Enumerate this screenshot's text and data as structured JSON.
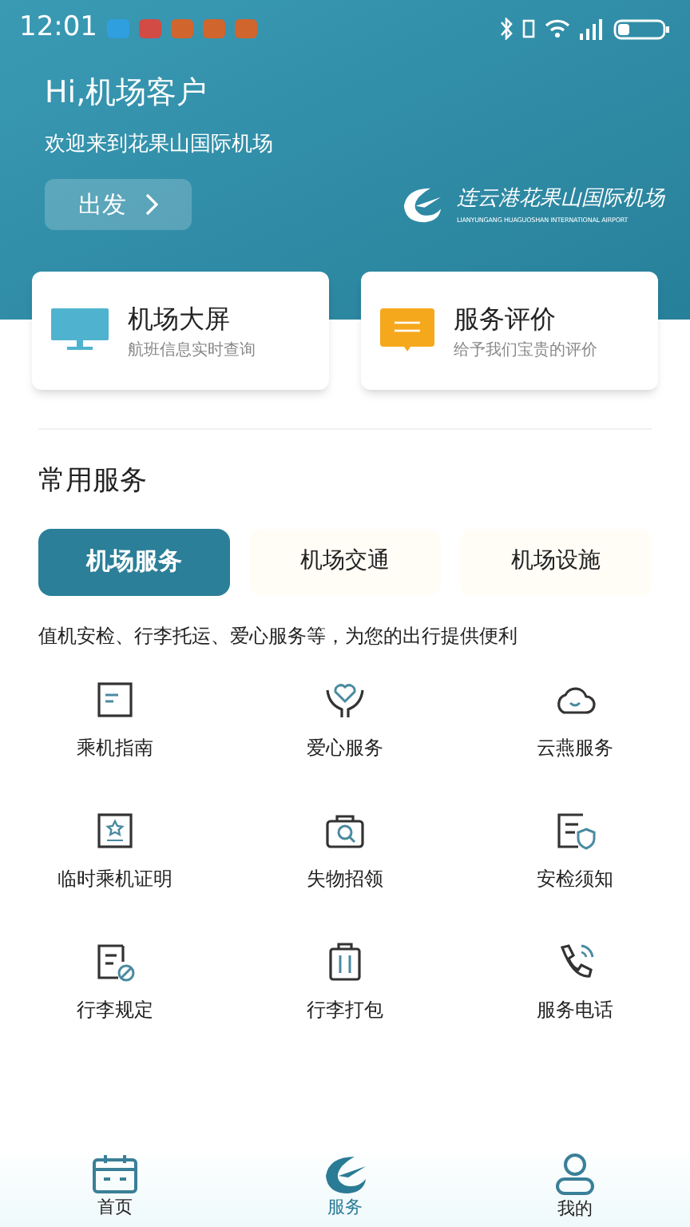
{
  "status_bar": {
    "time": "12:01"
  },
  "header": {
    "greeting": "Hi,机场客户",
    "welcome": "欢迎来到花果山国际机场",
    "depart_button": "出发",
    "airport_name": "连云港花果山国际机场",
    "airport_name_en": "LIANYUNGANG HUAGUOSHAN INTERNATIONAL AIRPORT"
  },
  "quick_cards": [
    {
      "kind": "screen",
      "title": "机场大屏",
      "subtitle": "航班信息实时查询"
    },
    {
      "kind": "review",
      "title": "服务评价",
      "subtitle": "给予我们宝贵的评价"
    }
  ],
  "section_title": "常用服务",
  "tabs": [
    {
      "label": "机场服务",
      "selected": true
    },
    {
      "label": "机场交通",
      "selected": false
    },
    {
      "label": "机场设施",
      "selected": false
    }
  ],
  "tab_description": "值机安检、行李托运、爱心服务等，为您的出行提供便利",
  "services": [
    {
      "kind": "guide",
      "label": "乘机指南"
    },
    {
      "kind": "care",
      "label": "爱心服务"
    },
    {
      "kind": "cloud",
      "label": "云燕服务"
    },
    {
      "kind": "certificate",
      "label": "临时乘机证明"
    },
    {
      "kind": "lost",
      "label": "失物招领"
    },
    {
      "kind": "security",
      "label": "安检须知"
    },
    {
      "kind": "rules",
      "label": "行李规定"
    },
    {
      "kind": "luggage",
      "label": "行李打包"
    },
    {
      "kind": "phone",
      "label": "服务电话"
    }
  ],
  "bottom_nav": [
    {
      "kind": "home",
      "label": "首页",
      "selected": false
    },
    {
      "kind": "service",
      "label": "服务",
      "selected": true
    },
    {
      "kind": "me",
      "label": "我的",
      "selected": false
    }
  ]
}
